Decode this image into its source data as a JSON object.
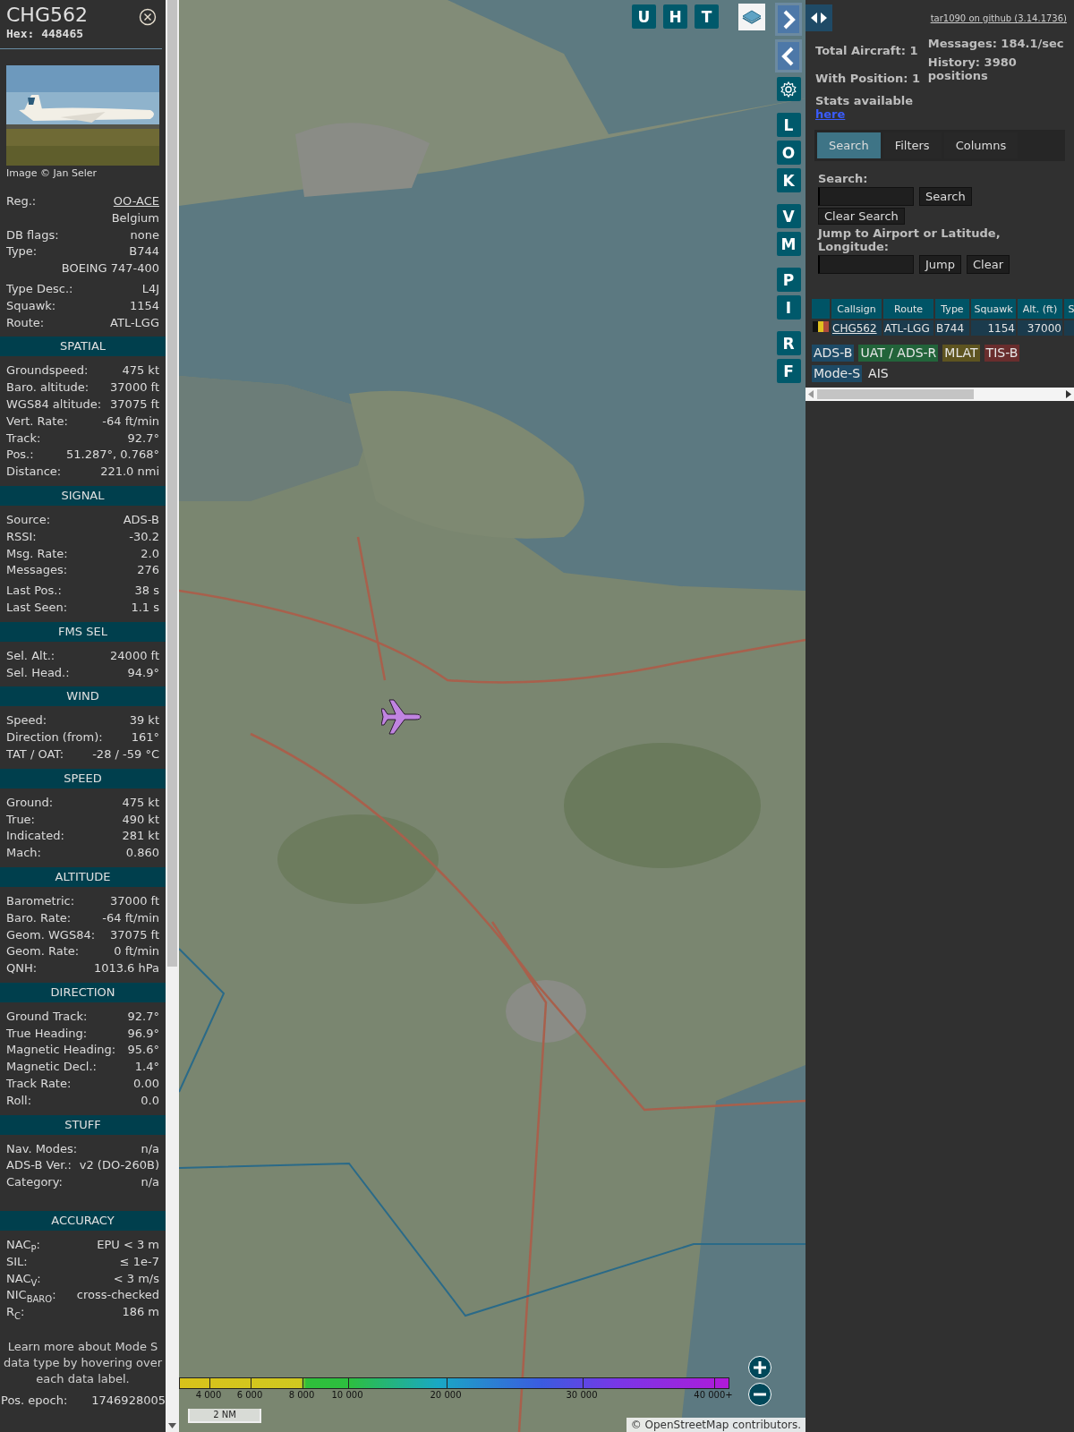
{
  "aircraft": {
    "callsign": "CHG562",
    "hex_label": "Hex:",
    "hex": "448465",
    "photo": {
      "kind": "picture",
      "credit": "Image © Jan Seler"
    },
    "groups": [
      [
        {
          "label": "Reg.:",
          "value": "OO-ACE",
          "link": true
        },
        {
          "value": "Belgium"
        },
        {
          "label": "DB flags:",
          "value": "none"
        },
        {
          "label": "Type:",
          "value": "B744"
        },
        {
          "value": "BOEING 747-400"
        }
      ],
      [
        {
          "label": "Type Desc.:",
          "value": "L4J"
        },
        {
          "label": "Squawk:",
          "value": "1154"
        },
        {
          "label": "Route:",
          "value": "ATL-LGG"
        }
      ]
    ]
  },
  "sections": [
    {
      "title": "SPATIAL",
      "groups": [
        [
          {
            "label": "Groundspeed:",
            "value": "475 kt"
          },
          {
            "label": "Baro. altitude:",
            "value": "37000 ft"
          },
          {
            "label": "WGS84 altitude:",
            "value": "37075 ft"
          },
          {
            "label": "Vert. Rate:",
            "value": "-64 ft/min"
          },
          {
            "label": "Track:",
            "value": "92.7°"
          },
          {
            "label": "Pos.:",
            "value": "51.287°, 0.768°"
          },
          {
            "label": "Distance:",
            "value": "221.0 nmi"
          }
        ]
      ]
    },
    {
      "title": "SIGNAL",
      "groups": [
        [
          {
            "label": "Source:",
            "value": "ADS-B"
          },
          {
            "label": "RSSI:",
            "value": "-30.2"
          },
          {
            "label": "Msg. Rate:",
            "value": "2.0"
          },
          {
            "label": "Messages:",
            "value": "276"
          }
        ],
        [
          {
            "label": "Last Pos.:",
            "value": "38 s"
          },
          {
            "label": "Last Seen:",
            "value": "1.1 s"
          }
        ]
      ]
    },
    {
      "title": "FMS SEL",
      "groups": [
        [
          {
            "label": "Sel. Alt.:",
            "value": "24000 ft"
          },
          {
            "label": "Sel. Head.:",
            "value": "94.9°"
          }
        ]
      ]
    },
    {
      "title": "WIND",
      "groups": [
        [
          {
            "label": "Speed:",
            "value": "39 kt"
          },
          {
            "label": "Direction (from):",
            "value": "161°"
          },
          {
            "label": "TAT / OAT:",
            "value": "-28 / -59 °C"
          }
        ]
      ]
    },
    {
      "title": "SPEED",
      "groups": [
        [
          {
            "label": "Ground:",
            "value": "475 kt"
          },
          {
            "label": "True:",
            "value": "490 kt"
          },
          {
            "label": "Indicated:",
            "value": "281 kt"
          },
          {
            "label": "Mach:",
            "value": "0.860"
          }
        ]
      ]
    },
    {
      "title": "ALTITUDE",
      "groups": [
        [
          {
            "label": "Barometric:",
            "value": "37000 ft"
          },
          {
            "label": "Baro. Rate:",
            "value": "-64 ft/min"
          },
          {
            "label": "Geom. WGS84:",
            "value": "37075 ft"
          },
          {
            "label": "Geom. Rate:",
            "value": "0 ft/min"
          },
          {
            "label": "QNH:",
            "value": "1013.6 hPa"
          }
        ]
      ]
    },
    {
      "title": "DIRECTION",
      "groups": [
        [
          {
            "label": "Ground Track:",
            "value": "92.7°"
          },
          {
            "label": "True Heading:",
            "value": "96.9°"
          },
          {
            "label": "Magnetic Heading:",
            "value": "95.6°"
          },
          {
            "label": "Magnetic Decl.:",
            "value": "1.4°"
          },
          {
            "label": "Track Rate:",
            "value": "0.00"
          },
          {
            "label": "Roll:",
            "value": "0.0"
          }
        ]
      ]
    },
    {
      "title": "STUFF",
      "groups": [
        [
          {
            "label": "Nav. Modes:",
            "value": "n/a"
          },
          {
            "label": "ADS-B Ver.:",
            "value": "v2 (DO-260B)"
          },
          {
            "label": "Category:",
            "value": "n/a"
          }
        ]
      ]
    },
    {
      "title": "ACCURACY",
      "groups": [
        [
          {
            "label": "NAC$_{P}$:",
            "value": "EPU < 3 m"
          },
          {
            "label": "SIL:",
            "value": "≤ 1e-7"
          },
          {
            "label": "NAC$_{V}$:",
            "value": "< 3 m/s"
          },
          {
            "label": "NIC$_{BARO}$:",
            "value": "cross-checked"
          },
          {
            "label": "R$_{C}$:",
            "value": "186 m"
          }
        ]
      ]
    }
  ],
  "note": "Learn more about Mode S data type by hovering over each data label.",
  "epoch": {
    "label": "Pos. epoch:",
    "value": "1746928005"
  },
  "map": {
    "kind": "picture",
    "top_buttons": [
      "U",
      "H",
      "T"
    ],
    "side_buttons": [
      [
        "L",
        "O",
        "K"
      ],
      [
        "V",
        "M"
      ],
      [
        "P",
        "I"
      ],
      [
        "R",
        "F"
      ]
    ],
    "legend": [
      "4 000",
      "6 000",
      "8 000",
      "10 000",
      "20 000",
      "30 000",
      "40 000+"
    ],
    "scale": "2 NM",
    "attribution": "© OpenStreetMap contributors."
  },
  "panel": {
    "github": "tar1090 on github (3.14.1736)",
    "stats_left": [
      "Total Aircraft: 1",
      "With Position: 1"
    ],
    "stats_right": [
      "Messages: 184.1/sec",
      "History: 3980 positions"
    ],
    "stats_note": "Stats available",
    "stats_link": "here",
    "tabs": [
      {
        "label": "Search",
        "selected": true
      },
      {
        "label": "Filters",
        "selected": false
      },
      {
        "label": "Columns",
        "selected": false
      }
    ],
    "search_label": "Search:",
    "search_button": "Search",
    "clear_search": "Clear Search",
    "jump_label": "Jump to Airport or Latitude, Longitude:",
    "jump_button": "Jump",
    "clear_button": "Clear",
    "table": {
      "columns": [
        "Callsign",
        "Route",
        "Type",
        "Squawk",
        "Alt. (ft)",
        "S"
      ],
      "rows": [
        {
          "cells": [
            "CHG562",
            "ATL-LGG",
            "B744",
            "1154",
            "37000"
          ]
        }
      ]
    },
    "sources": [
      {
        "label": "ADS-B",
        "color": "#1d4a66"
      },
      {
        "label": "UAT / ADS-R",
        "color": "#22643a"
      },
      {
        "label": "MLAT",
        "color": "#5e5420"
      },
      {
        "label": "TIS-B",
        "color": "#692d2d"
      },
      {
        "label": "Mode-S",
        "color": "#1d4a66"
      },
      {
        "label": "AIS"
      }
    ]
  }
}
